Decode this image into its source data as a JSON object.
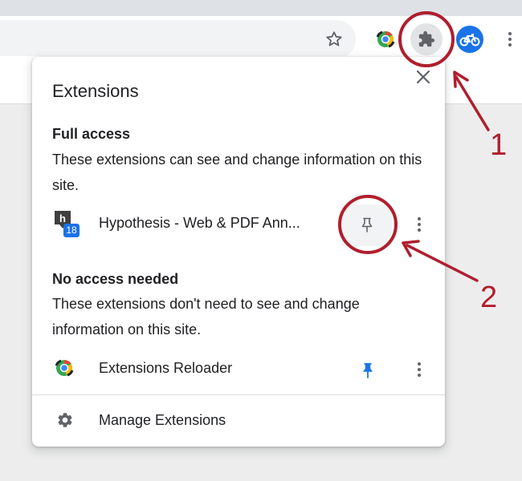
{
  "colors": {
    "accent": "#1a73e8",
    "annotation": "#b01e2d",
    "text": "#202124",
    "icon_gray": "#5f6368"
  },
  "toolbar": {
    "icons": [
      "star-icon",
      "extensions-reloader-icon",
      "puzzle-icon",
      "bike-icon",
      "more-vert-icon"
    ]
  },
  "popup": {
    "title": "Extensions",
    "full_access": {
      "heading": "Full access",
      "description": "These extensions can see and change information on this site.",
      "items": [
        {
          "name": "Hypothesis - Web & PDF Ann...",
          "badge": "18",
          "pinned": false
        }
      ]
    },
    "no_access": {
      "heading": "No access needed",
      "description": "These extensions don't need to see and change information on this site.",
      "items": [
        {
          "name": "Extensions Reloader",
          "pinned": true
        }
      ]
    },
    "manage_label": "Manage Extensions"
  },
  "annotations": {
    "label1": "1",
    "label2": "2"
  }
}
